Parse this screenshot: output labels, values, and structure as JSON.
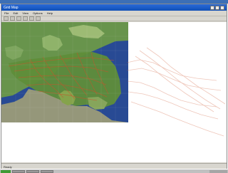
{
  "window": {
    "title": "Grid Map",
    "controls": [
      "minimize",
      "maximize",
      "close"
    ]
  },
  "menu": {
    "items": [
      "File",
      "Edit",
      "View",
      "Options",
      "Help"
    ]
  },
  "toolbar": {
    "icons": [
      "zoom-in-icon",
      "zoom-out-icon",
      "pan-icon",
      "layer-icon",
      "info-icon",
      "print-icon"
    ]
  },
  "status": {
    "text": "Ready"
  },
  "colors": {
    "title_blue": "#1c5fd0",
    "sea": "#2c4d97",
    "land": "#6e9a45",
    "grid_lines": "#c9532b"
  }
}
